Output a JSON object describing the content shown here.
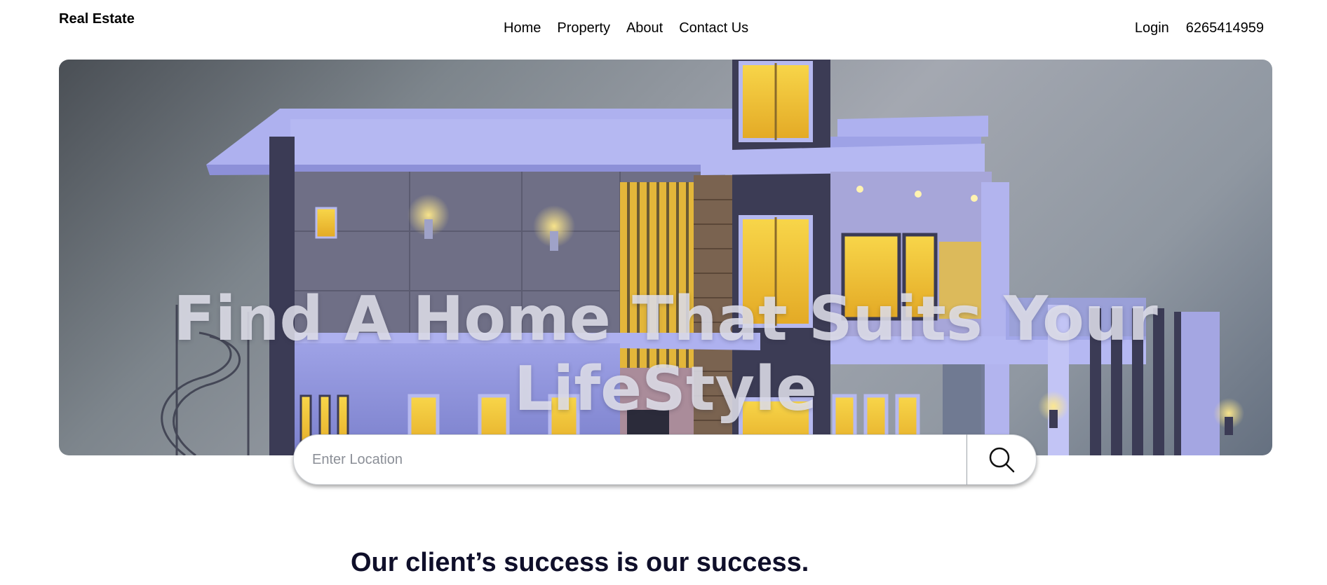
{
  "header": {
    "brand": "Real Estate",
    "nav": [
      {
        "label": "Home"
      },
      {
        "label": "Property"
      },
      {
        "label": "About"
      },
      {
        "label": "Contact Us"
      }
    ],
    "login_label": "Login",
    "phone": "6265414959"
  },
  "hero": {
    "title": "Find A Home That Suits Your LifeStyle"
  },
  "search": {
    "placeholder": "Enter Location",
    "value": "",
    "button_icon": "search-icon"
  },
  "section": {
    "heading": "Our client’s success is our success."
  },
  "colors": {
    "heading": "#0f0f2a",
    "hero_title": "#e1e1eb",
    "window_glow": "#f2c531"
  }
}
